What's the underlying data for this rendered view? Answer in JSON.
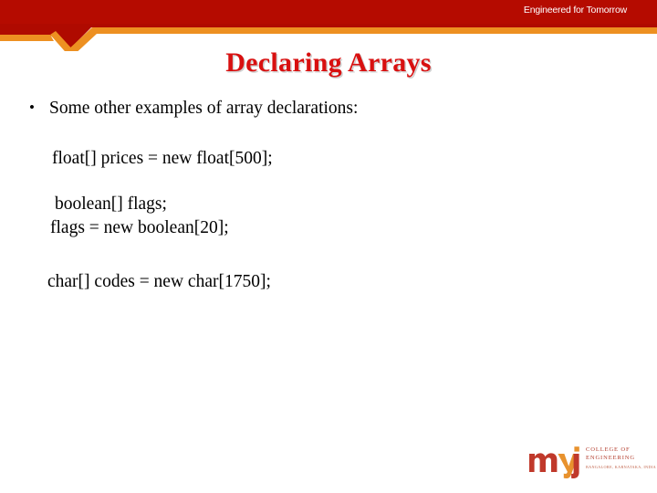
{
  "slide": {
    "title": "Declaring Arrays",
    "background_color": "#ffffff"
  },
  "header": {
    "tagline": "Engineered for Tomorrow",
    "red_color": "#b50b00",
    "orange_color": "#ed9021",
    "shadow_color": "#9e0a00"
  },
  "body": {
    "bullet_marker": "•",
    "bullet_text": "Some other examples of array declarations:",
    "code_lines": [
      "float[] prices = new float[500];",
      "boolean[] flags;",
      "flags = new boolean[20];",
      "char[] codes = new char[1750];"
    ]
  },
  "footer": {
    "logo_wordmark": "mvj",
    "logo_line_1": "COLLEGE OF",
    "logo_line_2": "ENGINEERING",
    "logo_tagline": "BANGALORE, KARNATAKA, INDIA",
    "logo_red": "#c0392b",
    "logo_orange": "#e8922e"
  },
  "title_color": "#d81010"
}
